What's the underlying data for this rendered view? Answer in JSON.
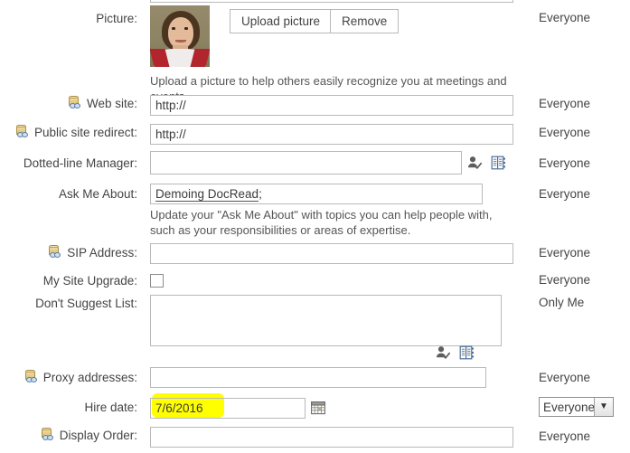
{
  "form": {
    "rows": [
      {
        "id": "picture",
        "label": "Picture:",
        "has_db_icon": false,
        "privacy": "Everyone",
        "upload_label": "Upload picture",
        "remove_label": "Remove",
        "hint": "Upload a picture to help others easily recognize you at meetings and events.",
        "avatar_alt": "profile-photo"
      },
      {
        "id": "web-site",
        "label": "Web site:",
        "has_db_icon": true,
        "privacy": "Everyone",
        "value": "http://"
      },
      {
        "id": "public-site-redirect",
        "label": "Public site redirect:",
        "has_db_icon": true,
        "privacy": "Everyone",
        "value": "http://"
      },
      {
        "id": "dotted-line-manager",
        "label": "Dotted-line Manager:",
        "has_db_icon": false,
        "privacy": "Everyone",
        "value": ""
      },
      {
        "id": "ask-me-about",
        "label": "Ask Me About:",
        "has_db_icon": false,
        "privacy": "Everyone",
        "value": "Demoing DocRead",
        "value_suffix": ";",
        "hint": "Update your \"Ask Me About\" with topics you can help people with, such as your responsibilities or areas of expertise."
      },
      {
        "id": "sip-address",
        "label": "SIP Address:",
        "has_db_icon": true,
        "privacy": "Everyone",
        "value": ""
      },
      {
        "id": "my-site-upgrade",
        "label": "My Site Upgrade:",
        "has_db_icon": false,
        "privacy": "Everyone",
        "checked": false
      },
      {
        "id": "dont-suggest-list",
        "label": "Don't Suggest List:",
        "has_db_icon": false,
        "privacy": "Only Me",
        "value": ""
      },
      {
        "id": "proxy-addresses",
        "label": "Proxy addresses:",
        "has_db_icon": true,
        "privacy": "Everyone",
        "value": ""
      },
      {
        "id": "hire-date",
        "label": "Hire date:",
        "has_db_icon": false,
        "privacy": "Everyone",
        "value": "7/6/2016",
        "highlighted": true
      },
      {
        "id": "display-order",
        "label": "Display Order:",
        "has_db_icon": true,
        "privacy": "Everyone",
        "value": ""
      }
    ]
  },
  "icons": {
    "db_link": "database-link-icon",
    "check_names": "check-names-icon",
    "address_book": "address-book-icon",
    "calendar": "calendar-icon",
    "dropdown_arrow": "chevron-down-icon"
  },
  "colors": {
    "highlight": "#ffff00",
    "border": "#b9b9b9",
    "text": "#444444"
  }
}
